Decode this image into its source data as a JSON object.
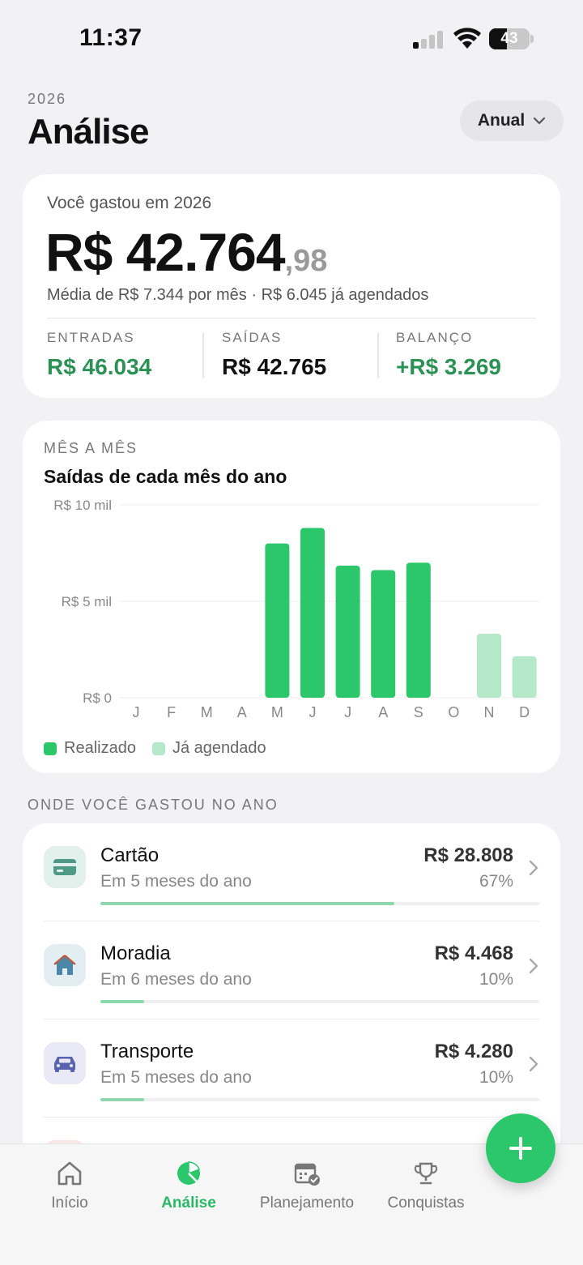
{
  "status": {
    "time": "11:37",
    "battery": "43",
    "battery_level": 0.43
  },
  "header": {
    "year": "2026",
    "title": "Análise",
    "period": "Anual"
  },
  "summary": {
    "label": "Você gastou em 2026",
    "amount": "R$ 42.764",
    "cents": ",98",
    "average": "Média de R$ 7.344 por mês · R$ 6.045 já agendados",
    "stats": [
      {
        "label": "ENTRADAS",
        "value": "R$ 46.034"
      },
      {
        "label": "SAÍDAS",
        "value": "R$ 42.765"
      },
      {
        "label": "BALANÇO",
        "value": "+R$ 3.269"
      }
    ]
  },
  "chart": {
    "kicker": "MÊS A MÊS",
    "title": "Saídas de cada mês do ano",
    "legend": [
      {
        "label": "Realizado",
        "color": "#2dc76b"
      },
      {
        "label": "Já agendado",
        "color": "#b4e8c8"
      }
    ]
  },
  "chart_data": {
    "type": "bar",
    "categories": [
      "J",
      "F",
      "M",
      "A",
      "M",
      "J",
      "J",
      "A",
      "S",
      "O",
      "N",
      "D"
    ],
    "ylim": [
      0,
      10000
    ],
    "y_ticks": [
      "R$ 0",
      "R$ 5 mil",
      "R$ 10 mil"
    ],
    "y_tick_values": [
      0,
      5000,
      10000
    ],
    "series": [
      {
        "name": "Realizado",
        "color": "#2dc76b",
        "values": [
          0,
          0,
          0,
          0,
          8000,
          8800,
          6850,
          6620,
          7000,
          0,
          0,
          0
        ]
      },
      {
        "name": "Já agendado",
        "color": "#b4e8c8",
        "values": [
          0,
          0,
          0,
          0,
          0,
          0,
          0,
          0,
          0,
          0,
          3320,
          2150
        ]
      }
    ]
  },
  "spending": {
    "section": "ONDE VOCÊ GASTOU NO ANO",
    "items": [
      {
        "name": "Cartão",
        "sub": "Em 5 meses do ano",
        "value": "R$ 28.808",
        "pct": "67%",
        "share": 0.67,
        "icon": "card-icon",
        "icon_bg": "#e3f1ec",
        "icon_color": "#4e9a86"
      },
      {
        "name": "Moradia",
        "sub": "Em 6 meses do ano",
        "value": "R$ 4.468",
        "pct": "10%",
        "share": 0.1,
        "icon": "house-icon",
        "icon_bg": "#e3eef2",
        "icon_color": "#4a86a8"
      },
      {
        "name": "Transporte",
        "sub": "Em 5 meses do ano",
        "value": "R$ 4.280",
        "pct": "10%",
        "share": 0.1,
        "icon": "car-icon",
        "icon_bg": "#e8e9f4",
        "icon_color": "#5a63b0"
      }
    ]
  },
  "tabs": [
    {
      "label": "Início",
      "icon": "home-icon",
      "active": false
    },
    {
      "label": "Análise",
      "icon": "pie-chart-icon",
      "active": true
    },
    {
      "label": "Planejamento",
      "icon": "calendar-check-icon",
      "active": false
    },
    {
      "label": "Conquistas",
      "icon": "trophy-icon",
      "active": false
    }
  ],
  "colors": {
    "accent": "#2dc76b",
    "positive": "#2b9155"
  }
}
